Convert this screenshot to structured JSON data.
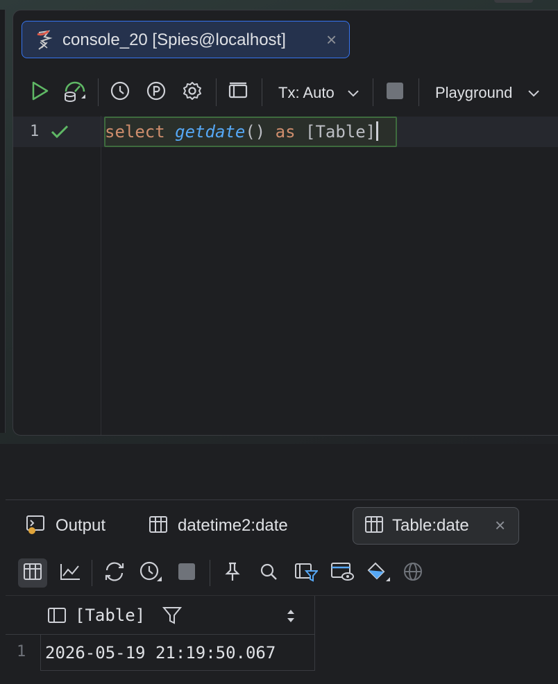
{
  "editor_tab": {
    "label": "console_20 [Spies@localhost]",
    "close_glyph": "×",
    "icon": "sql-server-icon"
  },
  "toolbar": {
    "run_icon": "play-icon",
    "datasource_icon": "database-dashboard-icon",
    "history_icon": "clock-icon",
    "params_icon": "parameter-p-icon",
    "settings_icon": "gear-icon",
    "layout_icon": "panel-layout-icon",
    "tx_label": "Tx: Auto",
    "stop_icon": "stop-icon",
    "schema_label": "Playground"
  },
  "editor": {
    "line_number": "1",
    "code": {
      "kw1": "select",
      "fn": "getdate",
      "parens": "()",
      "kw2": "as",
      "ident": "[Table]"
    }
  },
  "results": {
    "tabs": [
      {
        "label": "Output",
        "icon": "console-output-icon"
      },
      {
        "label": "datetime2:date",
        "icon": "table-icon"
      },
      {
        "label": "Table:date",
        "icon": "table-icon",
        "close_glyph": "×"
      }
    ],
    "grid": {
      "column": "[Table]",
      "rows": [
        {
          "num": "1",
          "value": "2026-05-19 21:19:50.067"
        }
      ]
    }
  },
  "colors": {
    "background": "#1e1f22",
    "accent": "#3574f0",
    "run_green": "#5fb865",
    "keyword": "#cf8e6d",
    "function": "#56a8f5"
  }
}
